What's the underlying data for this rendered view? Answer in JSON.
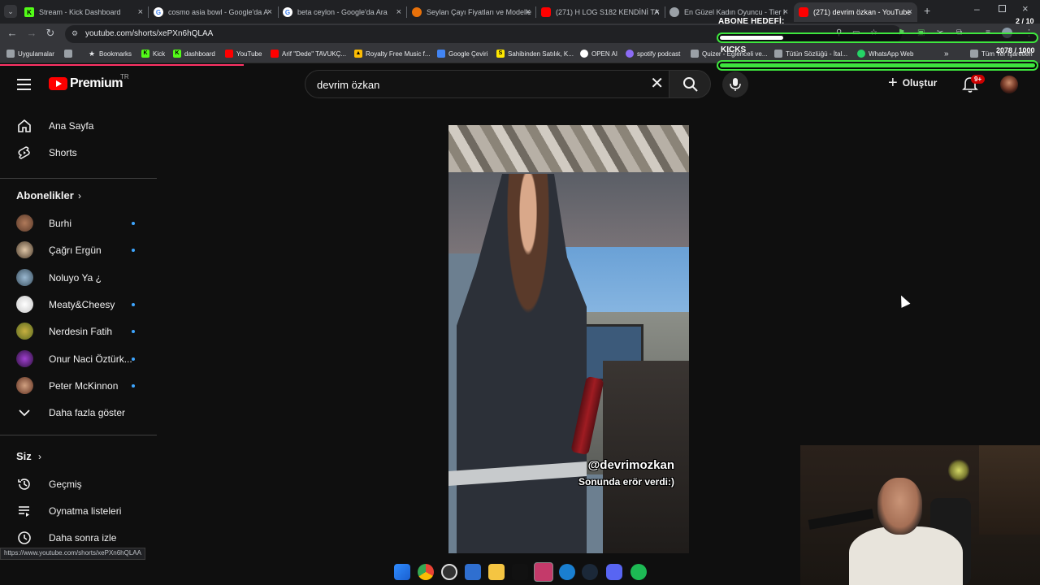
{
  "browser": {
    "tabs": [
      {
        "title": "Stream - Kick Dashboard",
        "icon": "kick-icon",
        "color": "#53fc18"
      },
      {
        "title": "cosmo asia bowl - Google'da A",
        "icon": "google-icon",
        "color": "#ffffff"
      },
      {
        "title": "beta ceylon - Google'da Ara",
        "icon": "google-icon",
        "color": "#ffffff"
      },
      {
        "title": "Seylan Çayı Fiyatları ve Modelle",
        "icon": "site-icon",
        "color": "#e8710a"
      },
      {
        "title": "(271) H LOG S182 KENDİNİ TA",
        "icon": "youtube-icon",
        "color": "#ff0000"
      },
      {
        "title": "En Güzel Kadın Oyuncu - Tier l",
        "icon": "site-icon",
        "color": "#9aa0a6"
      },
      {
        "title": "(271) devrim özkan - YouTube",
        "icon": "youtube-icon",
        "color": "#ff0000"
      }
    ],
    "url": "youtube.com/shorts/xePXn6hQLAA",
    "bookmarks": [
      {
        "label": "Uygulamalar",
        "color": "#9aa0a6"
      },
      {
        "label": "Bookmarks",
        "color": "#f1f1f1"
      },
      {
        "label": "Kick",
        "color": "#53fc18"
      },
      {
        "label": "dashboard",
        "color": "#53fc18"
      },
      {
        "label": "YouTube",
        "color": "#ff0000"
      },
      {
        "label": "Arif \"Dede\" TAVUKÇ...",
        "color": "#ff0000"
      },
      {
        "label": "Royalty Free Music f...",
        "color": "#fbbc04"
      },
      {
        "label": "Google Çeviri",
        "color": "#4285f4"
      },
      {
        "label": "Sahibinden Satılık, K...",
        "color": "#ffe800"
      },
      {
        "label": "OPEN AI",
        "color": "#ffffff"
      },
      {
        "label": "spotify podcast",
        "color": "#8c6cf5"
      },
      {
        "label": "Quizer - Eğlenceli ve...",
        "color": "#9aa0a6"
      },
      {
        "label": "Tütün Sözlüğü - İtal...",
        "color": "#9aa0a6"
      },
      {
        "label": "WhatsApp Web",
        "color": "#25d366"
      },
      {
        "label": "Tüm Yer İşaretleri",
        "color": "#9aa0a6"
      }
    ],
    "status_url": "https://www.youtube.com/shorts/xePXn6hQLAA"
  },
  "overlay": {
    "title": "ABONE HEDEFİ:",
    "count1": "2 / 10",
    "progress1": 0.2,
    "label2": "KICKS",
    "count2": "2078 / 1000",
    "progress2": 1.0,
    "accent": "#3ee63e"
  },
  "youtube": {
    "logo": "Premium",
    "region": "TR",
    "search_value": "devrim özkan",
    "create_label": "Oluştur",
    "notif_badge": "9+",
    "sidebar": {
      "home": "Ana Sayfa",
      "shorts": "Shorts",
      "subscriptions_heading": "Abonelikler",
      "channels": [
        {
          "name": "Burhi",
          "new": true
        },
        {
          "name": "Çağrı Ergün",
          "new": true
        },
        {
          "name": "Noluyo Ya ¿",
          "new": false
        },
        {
          "name": "Meaty&Cheesy",
          "new": true
        },
        {
          "name": "Nerdesin Fatih",
          "new": true
        },
        {
          "name": "Onur Naci Öztürk...",
          "new": true
        },
        {
          "name": "Peter McKinnon",
          "new": true
        }
      ],
      "show_more": "Daha fazla göster",
      "you_heading": "Siz",
      "history": "Geçmiş",
      "playlists": "Oynatma listeleri",
      "watch_later": "Daha sonra izle"
    },
    "video": {
      "caption_handle": "@devrimozkan",
      "caption_text": "Sonunda erör verdi:)"
    }
  }
}
